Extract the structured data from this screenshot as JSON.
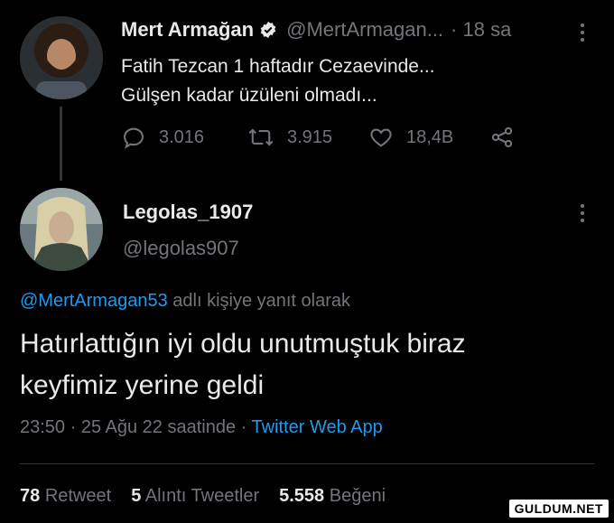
{
  "parent_tweet": {
    "display_name": "Mert Armağan",
    "handle": "@MertArmagan...",
    "time": "· 18 sa",
    "text_line1": "Fatih Tezcan 1 haftadır Cezaevinde...",
    "text_line2": "Gülşen kadar üzüleni olmadı...",
    "replies": "3.016",
    "retweets": "3.915",
    "likes": "18,4B"
  },
  "reply_tweet": {
    "display_name": "Legolas_1907",
    "handle": "@legolas907",
    "reply_to_handle": "@MertArmagan53",
    "reply_to_suffix": " adlı kişiye yanıt olarak",
    "text_line1": "Hatırlattığın iyi oldu unutmuştuk biraz",
    "text_line2": "keyfimiz yerine geldi",
    "timestamp": "23:50 · 25 Ağu 22 saatinde · ",
    "source": "Twitter Web App"
  },
  "stats": {
    "retweets_count": "78",
    "retweets_label": "Retweet",
    "quotes_count": "5",
    "quotes_label": "Alıntı Tweetler",
    "likes_count": "5.558",
    "likes_label": "Beğeni"
  },
  "watermark": "GULDUM.NET",
  "colors": {
    "background": "#000000",
    "text": "#e7e9ea",
    "muted": "#71767b",
    "link": "#1d9bf0",
    "verified": "#e7e9ea"
  }
}
